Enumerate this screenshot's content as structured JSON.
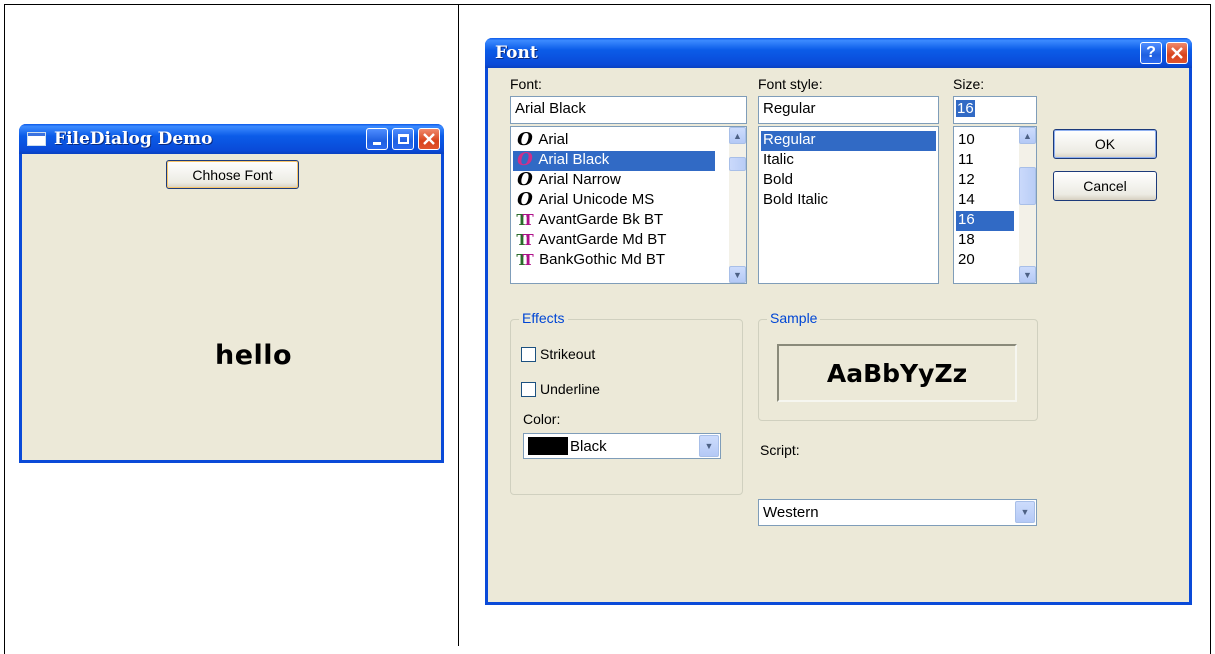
{
  "demo_window": {
    "title": "FileDialog Demo",
    "choose_button_label": "Chhose Font",
    "hello_text": "hello"
  },
  "font_dialog": {
    "title": "Font",
    "help_label": "?",
    "font_label": "Font:",
    "font_value": "Arial Black",
    "font_list": [
      "Arial",
      "Arial Black",
      "Arial Narrow",
      "Arial Unicode MS",
      "AvantGarde Bk BT",
      "AvantGarde Md BT",
      "BankGothic Md BT"
    ],
    "font_list_icons": [
      "opentype-icon",
      "opentype-icon",
      "opentype-icon",
      "opentype-icon",
      "truetype-icon",
      "truetype-icon",
      "truetype-icon"
    ],
    "selected_font_index": 1,
    "style_label": "Font style:",
    "style_value": "Regular",
    "style_list": [
      "Regular",
      "Italic",
      "Bold",
      "Bold Italic"
    ],
    "selected_style_index": 0,
    "size_label": "Size:",
    "size_value": "16",
    "size_list": [
      "10",
      "11",
      "12",
      "14",
      "16",
      "18",
      "20"
    ],
    "selected_size_index": 4,
    "ok_label": "OK",
    "cancel_label": "Cancel",
    "effects_label": "Effects",
    "strikeout_label": "Strikeout",
    "underline_label": "Underline",
    "color_label": "Color:",
    "color_value": "Black",
    "sample_label": "Sample",
    "sample_text": "AaBbYyZz",
    "script_label": "Script:",
    "script_value": "Western"
  },
  "colors": {
    "titlebar": "#0a4ad8",
    "selection": "#316ac5",
    "dialog_bg": "#ece9d8",
    "group_label": "#0046d5",
    "close_button": "#d8431c"
  }
}
